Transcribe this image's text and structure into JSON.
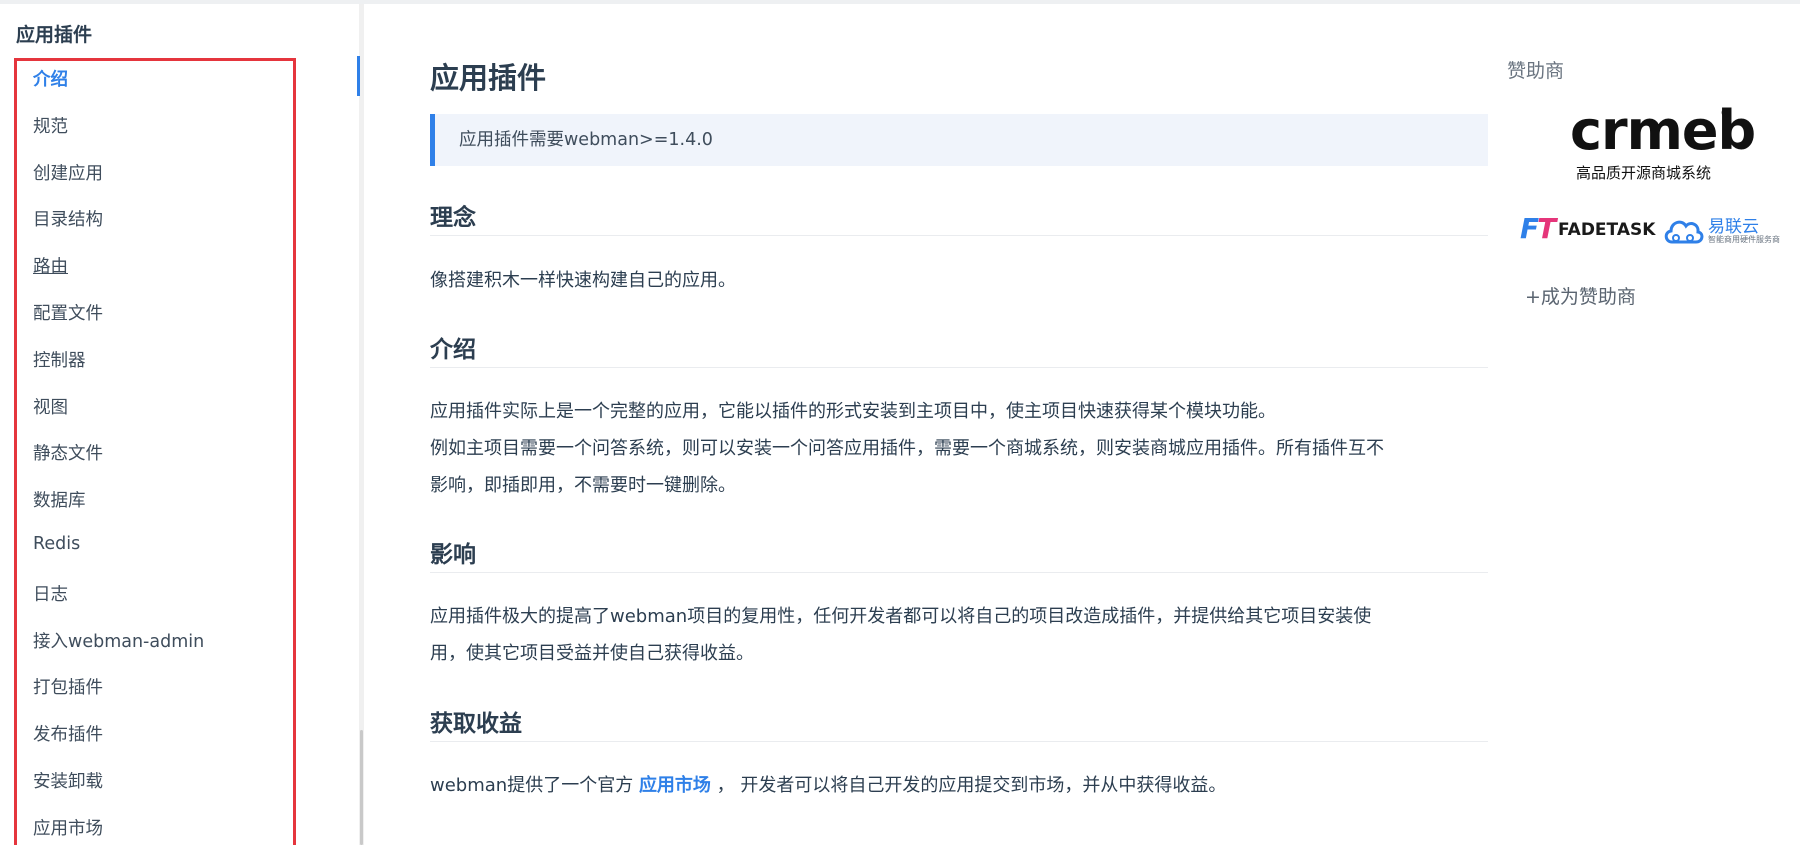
{
  "sidebar": {
    "heading": "应用插件",
    "items": [
      {
        "label": "介绍"
      },
      {
        "label": "规范"
      },
      {
        "label": "创建应用"
      },
      {
        "label": "目录结构"
      },
      {
        "label": "路由"
      },
      {
        "label": "配置文件"
      },
      {
        "label": "控制器"
      },
      {
        "label": "视图"
      },
      {
        "label": "静态文件"
      },
      {
        "label": "数据库"
      },
      {
        "label": "Redis"
      },
      {
        "label": "日志"
      },
      {
        "label": "接入webman-admin"
      },
      {
        "label": "打包插件"
      },
      {
        "label": "发布插件"
      },
      {
        "label": "安装卸载"
      },
      {
        "label": "应用市场"
      }
    ],
    "active_item": "介绍"
  },
  "main": {
    "title": "应用插件",
    "tip": "应用插件需要webman>=1.4.0",
    "sections": [
      {
        "heading": "理念",
        "paragraphs": [
          "像搭建积木一样快速构建自己的应用。"
        ]
      },
      {
        "heading": "介绍",
        "paragraphs": [
          "应用插件实际上是一个完整的应用，它能以插件的形式安装到主项目中，使主项目快速获得某个模块功能。",
          "例如主项目需要一个问答系统，则可以安装一个问答应用插件，需要一个商城系统，则安装商城应用插件。所有插件互不",
          "影响，即插即用，不需要时一键删除。"
        ]
      },
      {
        "heading": "影响",
        "paragraphs": [
          "应用插件极大的提高了webman项目的复用性，任何开发者都可以将自己的项目改造成插件，并提供给其它项目安装使",
          "用，使其它项目受益并使自己获得收益。"
        ]
      },
      {
        "heading": "获取收益",
        "paragraphs": []
      }
    ],
    "income_text_before": "webman提供了一个官方",
    "income_link": "应用市场",
    "income_text_after": "，  开发者可以将自己开发的应用提交到市场，并从中获得收益。"
  },
  "sponsors": {
    "title": "赞助商",
    "crmeb_logo_text": "crmeb",
    "crmeb_reg": "®",
    "crmeb_tagline": "高品质开源商城系统",
    "fadetask_mark_f": "F",
    "fadetask_mark_t": "T",
    "fadetask_name": "FADETASK",
    "ylc_name": "易联云",
    "ylc_tagline": "智能商用硬件服务商",
    "become_sponsor": "+成为赞助商"
  },
  "colors": {
    "accent": "#2f80e8",
    "highlight_box": "#e5353d",
    "text": "#2c3e50"
  }
}
